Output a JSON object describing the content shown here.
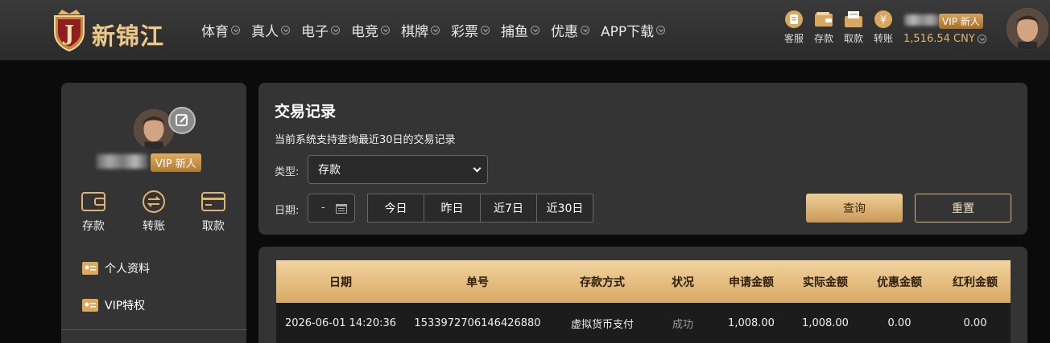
{
  "header": {
    "logo_text": "新锦江",
    "nav": [
      "体育",
      "真人",
      "电子",
      "电竞",
      "棋牌",
      "彩票",
      "捕鱼",
      "优惠",
      "APP下载"
    ],
    "quick_actions": [
      "客服",
      "存款",
      "取款",
      "转账"
    ],
    "vip_label": "VIP 新人",
    "balance": "1,516.54 CNY"
  },
  "sidebar": {
    "vip_label": "VIP 新人",
    "actions": [
      "存款",
      "转账",
      "取款"
    ],
    "menu": [
      "个人资料",
      "VIP特权"
    ]
  },
  "filter": {
    "title": "交易记录",
    "subtitle": "当前系统支持查询最近30日的交易记录",
    "type_label": "类型:",
    "type_value": "存款",
    "date_label": "日期:",
    "date_value": "-",
    "ranges": [
      "今日",
      "昨日",
      "近7日",
      "近30日"
    ],
    "query_label": "查询",
    "reset_label": "重置"
  },
  "table": {
    "columns": [
      "日期",
      "单号",
      "存款方式",
      "状况",
      "申请金额",
      "实际金额",
      "优惠金额",
      "红利金额"
    ],
    "rows": [
      [
        "2026-06-01 14:20:36",
        "1533972706146426880",
        "虚拟货币支付",
        "成功",
        "1,008.00",
        "1,008.00",
        "0.00",
        "0.00"
      ]
    ]
  },
  "colors": {
    "accent_gold": "#d8a963",
    "panel_bg": "#343434",
    "page_bg": "#0b0b0b"
  }
}
